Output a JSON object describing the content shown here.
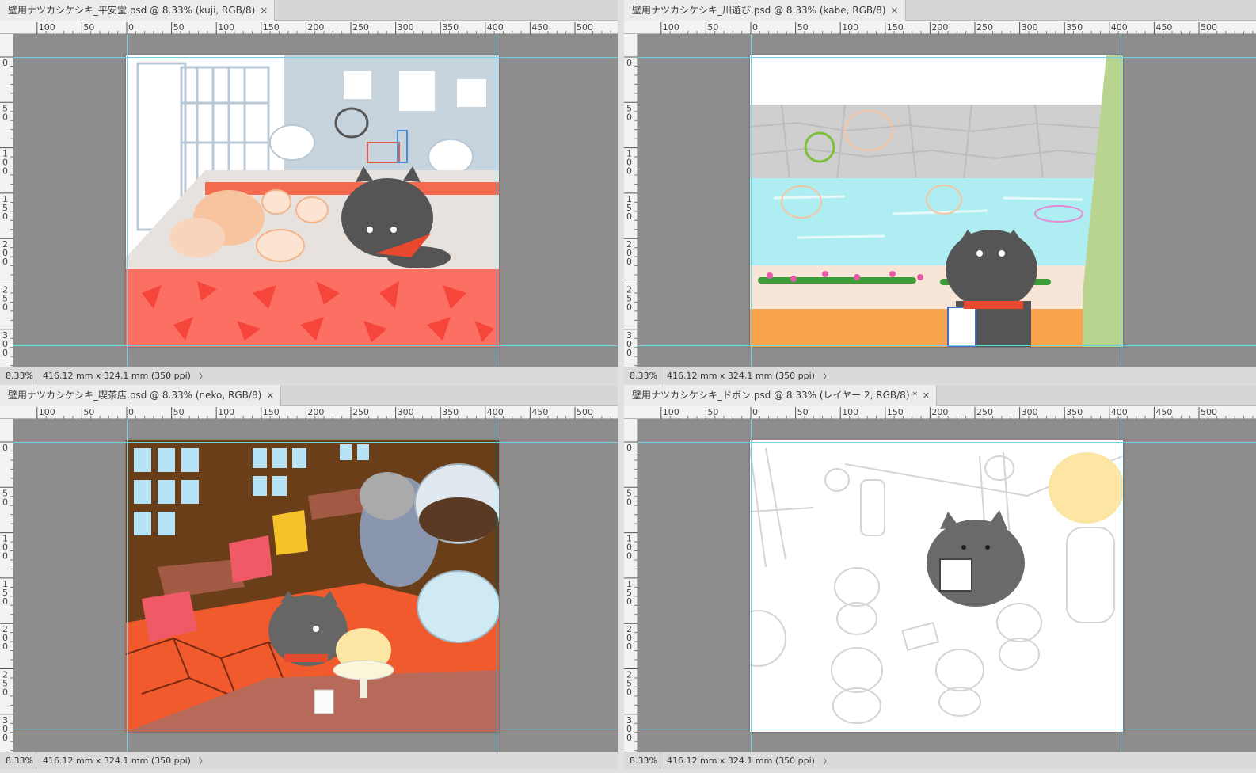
{
  "documents": [
    {
      "tab_title": "壁用ナツカシケシキ_平安堂.psd @ 8.33% (kuji, RGB/8)",
      "close_glyph": "×",
      "zoom": "8.33%",
      "doc_info": "416.12 mm x 324.1 mm (350 ppi)",
      "status_arrow": "〉"
    },
    {
      "tab_title": "壁用ナツカシケシキ_川遊び.psd @ 8.33% (kabe, RGB/8)",
      "close_glyph": "×",
      "zoom": "8.33%",
      "doc_info": "416.12 mm x 324.1 mm (350 ppi)",
      "status_arrow": "〉"
    },
    {
      "tab_title": "壁用ナツカシケシキ_喫茶店.psd @ 8.33% (neko, RGB/8)",
      "close_glyph": "×",
      "zoom": "8.33%",
      "doc_info": "416.12 mm x 324.1 mm (350 ppi)",
      "status_arrow": "〉"
    },
    {
      "tab_title": "壁用ナツカシケシキ_ドボン.psd @ 8.33% (レイヤー 2, RGB/8) *",
      "close_glyph": "×",
      "zoom": "8.33%",
      "doc_info": "416.12 mm x 324.1 mm (350 ppi)",
      "status_arrow": "〉"
    }
  ],
  "ruler": {
    "horizontal_labels": [
      "100",
      "50",
      "0",
      "50",
      "100",
      "150",
      "200",
      "250",
      "300",
      "350",
      "400",
      "450",
      "500"
    ],
    "vertical_labels": [
      "0",
      "50",
      "100",
      "150",
      "200",
      "250",
      "300"
    ]
  },
  "colors": {
    "workspace_gray": "#8d8d8d",
    "guide_cyan": "#6fd0e6",
    "ruler_bg": "#f3f3f3",
    "tab_bg": "#ececec"
  }
}
